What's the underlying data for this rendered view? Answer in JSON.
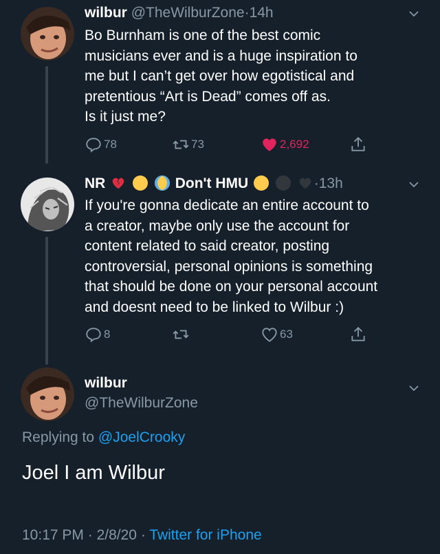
{
  "tweet1": {
    "name": "wilbur",
    "handle": "@TheWilburZone",
    "dot": "·",
    "time": "14h",
    "lines": [
      "Bo Burnham is one of the best comic",
      "musicians ever and is a huge inspiration to",
      "me but I can’t get over how egotistical and",
      "pretentious “Art is Dead” comes off as.",
      "Is it just me?"
    ],
    "replies": "78",
    "retweets": "73",
    "likes": "2,692",
    "liked": true
  },
  "tweet2": {
    "name_part1": "NR",
    "name_part2": "Don't HMU",
    "dot": "·",
    "time": "13h",
    "emojis": [
      "broken-heart",
      "smirk-face",
      "crying-face",
      "raised-eyebrow-face",
      "bomb",
      "black-heart"
    ],
    "lines": [
      "If you're gonna dedicate an entire account to",
      "a creator, maybe only use the account for",
      "content related to said creator, posting",
      "controversial, personal opinions is something",
      "that should be done on your personal account",
      "and doesnt need to be linked to Wilbur :)"
    ],
    "replies": "8",
    "retweets": "",
    "likes": "63"
  },
  "tweet3": {
    "name": "wilbur",
    "handle": "@TheWilburZone",
    "replying_prefix": "Replying to ",
    "replying_to": "@JoelCrooky",
    "text": "Joel I am Wilbur",
    "time": "10:17 PM",
    "sep1": "·",
    "date": "2/8/20",
    "sep2": "·",
    "source": "Twitter for iPhone"
  },
  "colors": {
    "background": "#15202b",
    "muted": "#8899a6",
    "link": "#1da1f2",
    "like": "#e0245e",
    "thread_line": "#38444d"
  }
}
